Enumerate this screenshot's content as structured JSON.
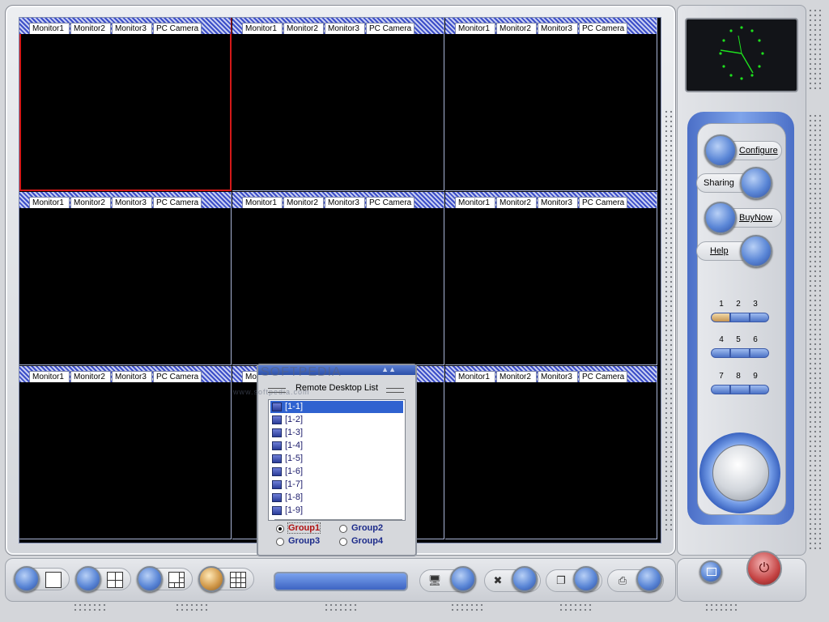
{
  "monitor_tabs": [
    "Monitor1",
    "Monitor2",
    "Monitor3",
    "PC Camera"
  ],
  "cells": [
    {
      "id": "1",
      "selected": true
    },
    {
      "id": "2"
    },
    {
      "id": "3"
    },
    {
      "id": "4"
    },
    {
      "id": "5"
    },
    {
      "id": "6"
    },
    {
      "id": "7"
    },
    {
      "id": "8"
    },
    {
      "id": "9"
    }
  ],
  "controls": {
    "configure": "Configure",
    "sharing": "Sharing",
    "buynow": "BuyNow",
    "help": "Help",
    "channel_numbers": [
      "1",
      "2",
      "3",
      "4",
      "5",
      "6",
      "7",
      "8",
      "9"
    ],
    "active_channel": "1"
  },
  "remote_desktop": {
    "title": "Remote Desktop List",
    "items": [
      "[1-1]",
      "[1-2]",
      "[1-3]",
      "[1-4]",
      "[1-5]",
      "[1-6]",
      "[1-7]",
      "[1-8]",
      "[1-9]"
    ],
    "selected_item": "[1-1]",
    "groups": [
      "Group1",
      "Group2",
      "Group3",
      "Group4"
    ],
    "selected_group": "Group1"
  },
  "watermark": "SOFTPEDIA",
  "watermark_url": "www.softpedia.com",
  "colors": {
    "accent": "#4b6fc7",
    "selected_border": "#d41818",
    "clock": "#1ee01e"
  }
}
